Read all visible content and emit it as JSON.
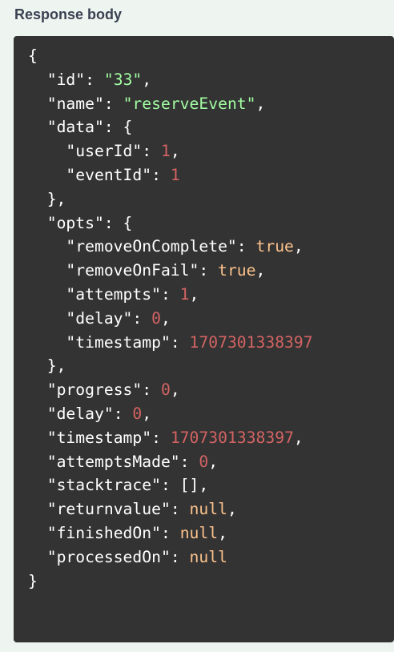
{
  "section": {
    "title": "Response body"
  },
  "response": {
    "lines": [
      [
        {
          "t": "p",
          "v": "{"
        }
      ],
      [
        {
          "t": "p",
          "v": "  "
        },
        {
          "t": "k",
          "v": "\"id\""
        },
        {
          "t": "p",
          "v": ": "
        },
        {
          "t": "s",
          "v": "\"33\""
        },
        {
          "t": "p",
          "v": ","
        }
      ],
      [
        {
          "t": "p",
          "v": "  "
        },
        {
          "t": "k",
          "v": "\"name\""
        },
        {
          "t": "p",
          "v": ": "
        },
        {
          "t": "s",
          "v": "\"reserveEvent\""
        },
        {
          "t": "p",
          "v": ","
        }
      ],
      [
        {
          "t": "p",
          "v": "  "
        },
        {
          "t": "k",
          "v": "\"data\""
        },
        {
          "t": "p",
          "v": ": {"
        }
      ],
      [
        {
          "t": "p",
          "v": "    "
        },
        {
          "t": "k",
          "v": "\"userId\""
        },
        {
          "t": "p",
          "v": ": "
        },
        {
          "t": "n",
          "v": "1"
        },
        {
          "t": "p",
          "v": ","
        }
      ],
      [
        {
          "t": "p",
          "v": "    "
        },
        {
          "t": "k",
          "v": "\"eventId\""
        },
        {
          "t": "p",
          "v": ": "
        },
        {
          "t": "n",
          "v": "1"
        }
      ],
      [
        {
          "t": "p",
          "v": "  },"
        }
      ],
      [
        {
          "t": "p",
          "v": "  "
        },
        {
          "t": "k",
          "v": "\"opts\""
        },
        {
          "t": "p",
          "v": ": {"
        }
      ],
      [
        {
          "t": "p",
          "v": "    "
        },
        {
          "t": "k",
          "v": "\"removeOnComplete\""
        },
        {
          "t": "p",
          "v": ": "
        },
        {
          "t": "b",
          "v": "true"
        },
        {
          "t": "p",
          "v": ","
        }
      ],
      [
        {
          "t": "p",
          "v": "    "
        },
        {
          "t": "k",
          "v": "\"removeOnFail\""
        },
        {
          "t": "p",
          "v": ": "
        },
        {
          "t": "b",
          "v": "true"
        },
        {
          "t": "p",
          "v": ","
        }
      ],
      [
        {
          "t": "p",
          "v": "    "
        },
        {
          "t": "k",
          "v": "\"attempts\""
        },
        {
          "t": "p",
          "v": ": "
        },
        {
          "t": "n",
          "v": "1"
        },
        {
          "t": "p",
          "v": ","
        }
      ],
      [
        {
          "t": "p",
          "v": "    "
        },
        {
          "t": "k",
          "v": "\"delay\""
        },
        {
          "t": "p",
          "v": ": "
        },
        {
          "t": "n",
          "v": "0"
        },
        {
          "t": "p",
          "v": ","
        }
      ],
      [
        {
          "t": "p",
          "v": "    "
        },
        {
          "t": "k",
          "v": "\"timestamp\""
        },
        {
          "t": "p",
          "v": ": "
        },
        {
          "t": "n",
          "v": "1707301338397"
        }
      ],
      [
        {
          "t": "p",
          "v": "  },"
        }
      ],
      [
        {
          "t": "p",
          "v": "  "
        },
        {
          "t": "k",
          "v": "\"progress\""
        },
        {
          "t": "p",
          "v": ": "
        },
        {
          "t": "n",
          "v": "0"
        },
        {
          "t": "p",
          "v": ","
        }
      ],
      [
        {
          "t": "p",
          "v": "  "
        },
        {
          "t": "k",
          "v": "\"delay\""
        },
        {
          "t": "p",
          "v": ": "
        },
        {
          "t": "n",
          "v": "0"
        },
        {
          "t": "p",
          "v": ","
        }
      ],
      [
        {
          "t": "p",
          "v": "  "
        },
        {
          "t": "k",
          "v": "\"timestamp\""
        },
        {
          "t": "p",
          "v": ": "
        },
        {
          "t": "n",
          "v": "1707301338397"
        },
        {
          "t": "p",
          "v": ","
        }
      ],
      [
        {
          "t": "p",
          "v": "  "
        },
        {
          "t": "k",
          "v": "\"attemptsMade\""
        },
        {
          "t": "p",
          "v": ": "
        },
        {
          "t": "n",
          "v": "0"
        },
        {
          "t": "p",
          "v": ","
        }
      ],
      [
        {
          "t": "p",
          "v": "  "
        },
        {
          "t": "k",
          "v": "\"stacktrace\""
        },
        {
          "t": "p",
          "v": ": []"
        },
        {
          "t": "p",
          "v": ","
        }
      ],
      [
        {
          "t": "p",
          "v": "  "
        },
        {
          "t": "k",
          "v": "\"returnvalue\""
        },
        {
          "t": "p",
          "v": ": "
        },
        {
          "t": "b",
          "v": "null"
        },
        {
          "t": "p",
          "v": ","
        }
      ],
      [
        {
          "t": "p",
          "v": "  "
        },
        {
          "t": "k",
          "v": "\"finishedOn\""
        },
        {
          "t": "p",
          "v": ": "
        },
        {
          "t": "b",
          "v": "null"
        },
        {
          "t": "p",
          "v": ","
        }
      ],
      [
        {
          "t": "p",
          "v": "  "
        },
        {
          "t": "k",
          "v": "\"processedOn\""
        },
        {
          "t": "p",
          "v": ": "
        },
        {
          "t": "b",
          "v": "null"
        }
      ],
      [
        {
          "t": "p",
          "v": "}"
        }
      ]
    ]
  },
  "colors": {
    "background": "#eef5f0",
    "code_background": "#333333",
    "title": "#3b4151",
    "string": "#a2fca2",
    "number": "#d36363",
    "literal": "#fcc28c",
    "key": "#ffffff"
  }
}
